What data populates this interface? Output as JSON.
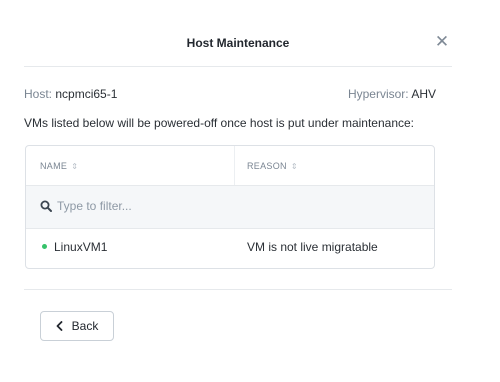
{
  "dialog": {
    "title": "Host Maintenance",
    "close_icon": "close-icon"
  },
  "host": {
    "label": "Host:",
    "name": "ncpmci65-1",
    "hypervisor_label": "Hypervisor:",
    "hypervisor": "AHV"
  },
  "note": "VMs listed below will be powered-off once host is put under maintenance:",
  "table": {
    "columns": [
      {
        "label": "NAME",
        "sort_icon": "sort-icon"
      },
      {
        "label": "REASON",
        "sort_icon": "sort-icon"
      }
    ],
    "filter": {
      "icon": "search-icon",
      "placeholder": "Type to filter..."
    },
    "rows": [
      {
        "status_color": "#36c26a",
        "name": "LinuxVM1",
        "reason": "VM is not live migratable"
      }
    ]
  },
  "footer": {
    "back_label": "Back",
    "back_icon": "chevron-left-icon"
  }
}
